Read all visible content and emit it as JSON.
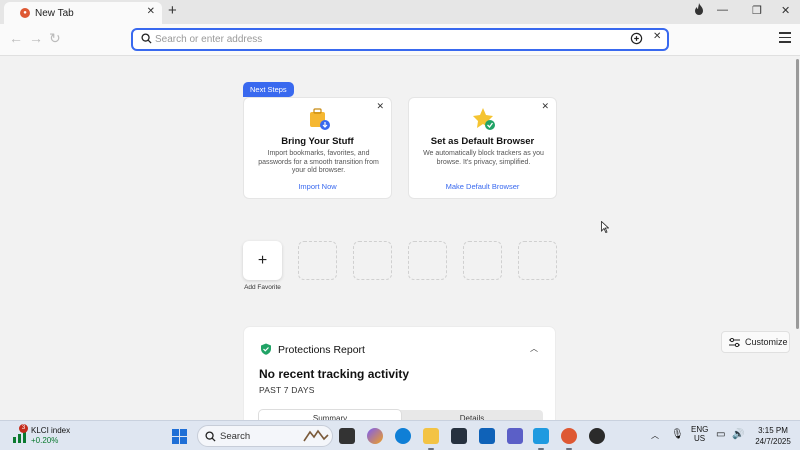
{
  "tab": {
    "title": "New Tab"
  },
  "address_bar": {
    "placeholder": "Search or enter address",
    "value": ""
  },
  "next_steps": {
    "badge": "Next Steps",
    "cards": [
      {
        "title": "Bring Your Stuff",
        "description": "Import bookmarks, favorites, and passwords for a smooth transition from your old browser.",
        "link": "Import Now",
        "icon": "import-icon"
      },
      {
        "title": "Set as Default Browser",
        "description": "We automatically block trackers as you browse. It's privacy, simplified.",
        "link": "Make Default Browser",
        "icon": "default-browser-star-icon"
      }
    ]
  },
  "favorites": {
    "add_label": "Add Favorite",
    "empty_slots": 5
  },
  "protections": {
    "title": "Protections Report",
    "heading": "No recent tracking activity",
    "period": "PAST 7 DAYS",
    "tabs": [
      "Summary",
      "Details"
    ]
  },
  "customize": {
    "label": "Customize"
  },
  "taskbar": {
    "widget": {
      "name": "KLCI index",
      "change": "+0.20%",
      "badge": "3"
    },
    "search_label": "Search",
    "tray": {
      "lang": "ENG",
      "region": "US"
    },
    "clock": {
      "time": "3:15 PM",
      "date": "24/7/2025"
    }
  },
  "colors": {
    "accent": "#3969ef",
    "brand": "#de5833",
    "protection_green": "#21a366",
    "stock_green": "#0b7a30"
  }
}
